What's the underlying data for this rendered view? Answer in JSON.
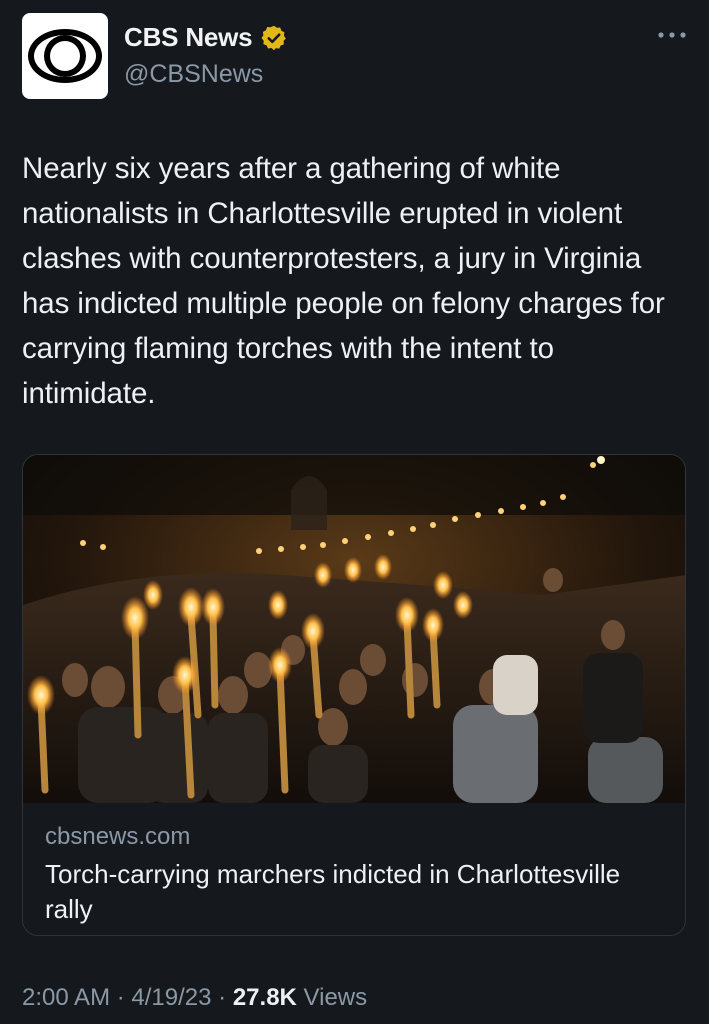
{
  "account": {
    "name": "CBS News",
    "handle": "@CBSNews",
    "verified_color": "#e2b719",
    "avatar_icon": "cbs-eye-logo"
  },
  "tweet": {
    "text": "Nearly six years after a gathering of white nationalists in Charlottesville erupted in violent clashes with counterprotesters, a jury in Virginia has indicted multiple people on felony charges for carrying flaming torches with the intent to intimidate."
  },
  "card": {
    "domain": "cbsnews.com",
    "title": "Torch-carrying marchers indicted in Charlottesville rally",
    "image_icon": "torch-march-photo"
  },
  "meta": {
    "time": "2:00 AM",
    "separator": "·",
    "date": "4/19/23",
    "views_count": "27.8K",
    "views_label": "Views"
  },
  "colors": {
    "background": "#15181d",
    "secondary_text": "#8b98a5",
    "primary_text": "#eef1f3"
  }
}
